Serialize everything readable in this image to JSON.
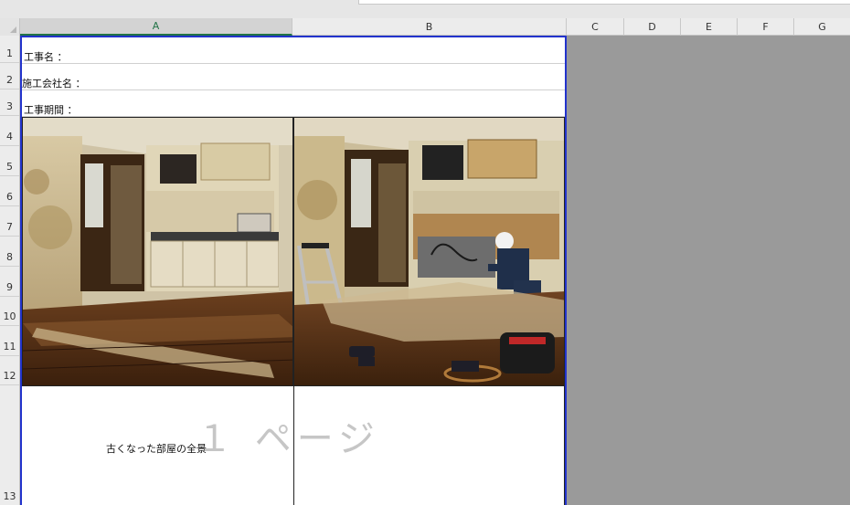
{
  "columns": [
    "A",
    "B",
    "C",
    "D",
    "E",
    "F",
    "G"
  ],
  "rows": [
    "1",
    "2",
    "3",
    "4",
    "5",
    "6",
    "7",
    "8",
    "9",
    "10",
    "11",
    "12",
    "13"
  ],
  "cells": {
    "a1": "工事名 ：",
    "a2": "施工会社名 ：",
    "a3": "工事期間 ：",
    "caption": "古くなった部屋の全景"
  },
  "page_break_label": "１ ページ",
  "photos": {
    "left": "before-renovation-room-photo",
    "right": "renovation-in-progress-photo"
  },
  "colors": {
    "print_area_border": "#2233cc",
    "non_print_area": "#9a9a9a",
    "active_header": "#217346"
  }
}
